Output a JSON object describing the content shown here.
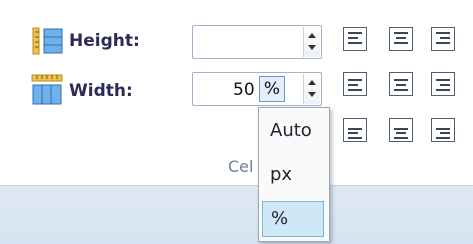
{
  "dimensions": {
    "height_label": "Height:",
    "height_value": "",
    "width_label": "Width:",
    "width_value": "50",
    "width_unit": "%"
  },
  "group": {
    "label": "Cel"
  },
  "unit_menu": {
    "items": [
      "Auto",
      "px",
      "%"
    ],
    "selected": "%"
  },
  "icons": {
    "height": "row-height-icon",
    "width": "column-width-icon",
    "align": [
      "align-top-left-icon",
      "align-top-center-icon",
      "align-top-right-icon",
      "align-middle-left-icon",
      "align-middle-center-icon",
      "align-middle-right-icon",
      "align-bottom-left-icon",
      "align-bottom-center-icon",
      "align-bottom-right-icon"
    ]
  },
  "colors": {
    "accent": "#5e97d6",
    "menu_selected": "#cfe8f6",
    "ribbon_footer": "#dfe9f5"
  }
}
